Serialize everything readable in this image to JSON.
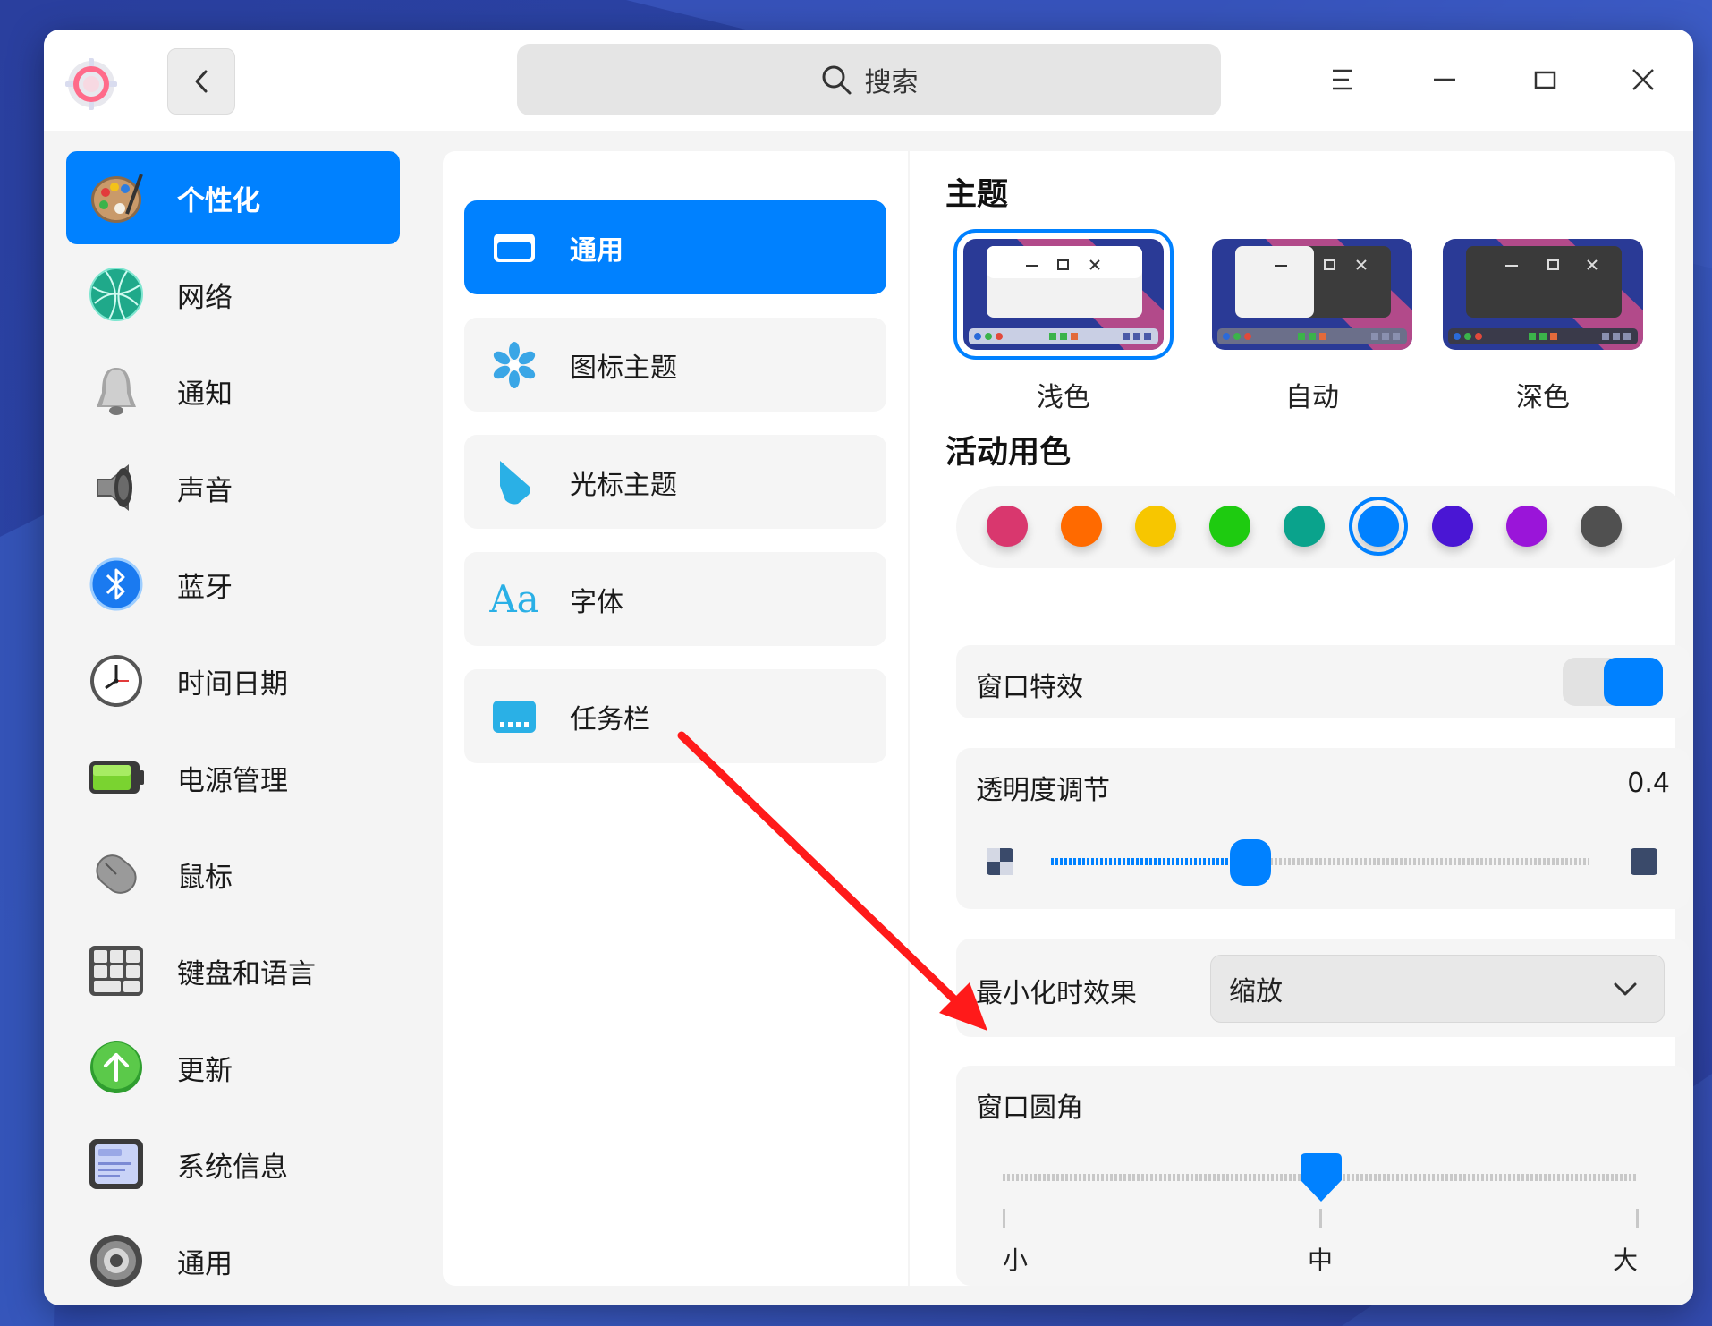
{
  "search": {
    "label": "搜索"
  },
  "sidebar": {
    "items": [
      {
        "label": "个性化",
        "icon": "palette-icon"
      },
      {
        "label": "网络",
        "icon": "globe-icon"
      },
      {
        "label": "通知",
        "icon": "bell-icon"
      },
      {
        "label": "声音",
        "icon": "speaker-icon"
      },
      {
        "label": "蓝牙",
        "icon": "bluetooth-icon"
      },
      {
        "label": "时间日期",
        "icon": "clock-icon"
      },
      {
        "label": "电源管理",
        "icon": "battery-icon"
      },
      {
        "label": "鼠标",
        "icon": "mouse-icon"
      },
      {
        "label": "键盘和语言",
        "icon": "keyboard-icon"
      },
      {
        "label": "更新",
        "icon": "update-arrow-icon"
      },
      {
        "label": "系统信息",
        "icon": "system-info-icon"
      },
      {
        "label": "通用",
        "icon": "gear-icon"
      }
    ]
  },
  "subnav": {
    "items": [
      {
        "label": "通用",
        "icon": "window-icon"
      },
      {
        "label": "图标主题",
        "icon": "snowflake-icon"
      },
      {
        "label": "光标主题",
        "icon": "cursor-icon"
      },
      {
        "label": "字体",
        "icon": "font-icon",
        "glyph": "Aa"
      },
      {
        "label": "任务栏",
        "icon": "taskbar-icon"
      }
    ]
  },
  "theme": {
    "title": "主题",
    "options": [
      {
        "label": "浅色",
        "selected": true
      },
      {
        "label": "自动",
        "selected": false
      },
      {
        "label": "深色",
        "selected": false
      }
    ]
  },
  "accent": {
    "title": "活动用色",
    "colors": [
      "#d9376e",
      "#ff6a00",
      "#f7c600",
      "#1ecb10",
      "#0aa38c",
      "#0081ff",
      "#4a16d4",
      "#9a15d9",
      "#505050"
    ],
    "selected_index": 5
  },
  "window_effects": {
    "label": "窗口特效",
    "enabled": true
  },
  "transparency": {
    "label": "透明度调节",
    "value": "0.4"
  },
  "minimize": {
    "label": "最小化时效果",
    "value": "缩放"
  },
  "corner": {
    "label": "窗口圆角",
    "ticks": [
      "小",
      "中",
      "大"
    ],
    "selected": "中"
  },
  "colors": {
    "accent": "#0081ff",
    "window_bg": "#f4f4f4"
  }
}
